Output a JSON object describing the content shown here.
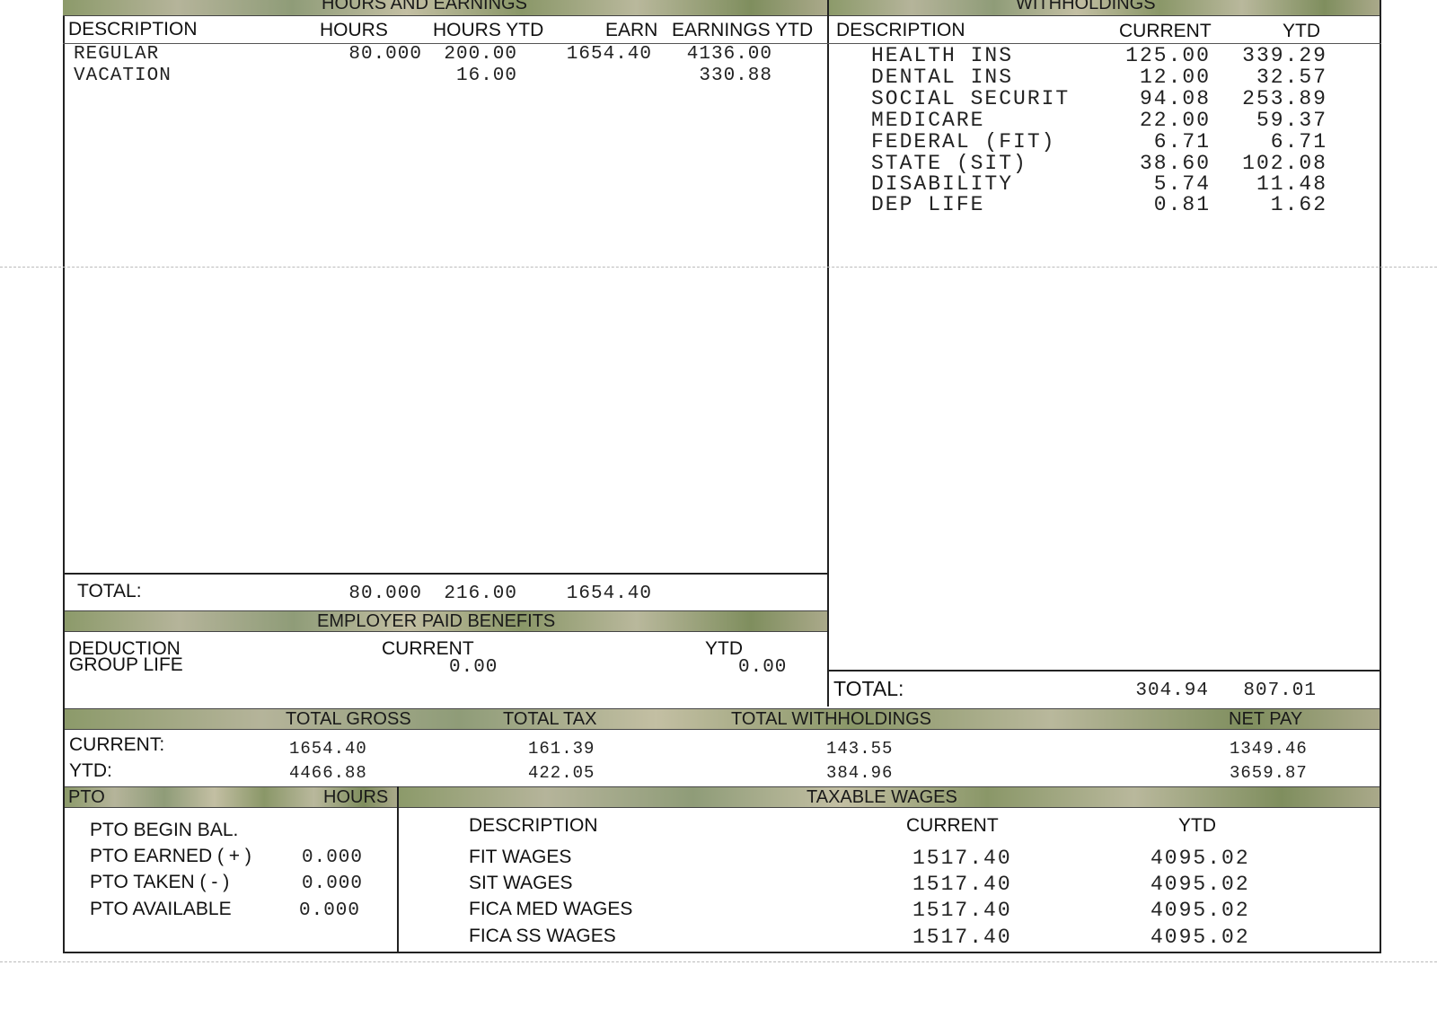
{
  "hours_earnings": {
    "title": "HOURS AND EARNINGS",
    "headers": [
      "DESCRIPTION",
      "HOURS",
      "HOURS YTD",
      "EARN",
      "EARNINGS YTD"
    ],
    "rows": [
      {
        "description": "REGULAR",
        "hours": "80.000",
        "hours_ytd": "200.00",
        "earn": "1654.40",
        "earnings_ytd": "4136.00"
      },
      {
        "description": "VACATION",
        "hours": "",
        "hours_ytd": "16.00",
        "earn": "",
        "earnings_ytd": "330.88"
      }
    ],
    "total": {
      "label": "TOTAL:",
      "hours": "80.000",
      "hours_ytd": "216.00",
      "earn": "1654.40"
    }
  },
  "withholdings": {
    "title": "WITHHOLDINGS",
    "headers": [
      "DESCRIPTION",
      "CURRENT",
      "YTD"
    ],
    "rows": [
      {
        "description": "HEALTH INS",
        "current": "125.00",
        "ytd": "339.29"
      },
      {
        "description": "DENTAL INS",
        "current": "12.00",
        "ytd": "32.57"
      },
      {
        "description": "SOCIAL SECURIT",
        "current": "94.08",
        "ytd": "253.89"
      },
      {
        "description": "MEDICARE",
        "current": "22.00",
        "ytd": "59.37"
      },
      {
        "description": "FEDERAL (FIT)",
        "current": "6.71",
        "ytd": "6.71"
      },
      {
        "description": "STATE (SIT)",
        "current": "38.60",
        "ytd": "102.08"
      },
      {
        "description": "DISABILITY",
        "current": "5.74",
        "ytd": "11.48"
      },
      {
        "description": "DEP LIFE",
        "current": "0.81",
        "ytd": "1.62"
      }
    ],
    "total": {
      "label": "TOTAL:",
      "current": "304.94",
      "ytd": "807.01"
    }
  },
  "employer_benefits": {
    "title": "EMPLOYER PAID BENEFITS",
    "headers": [
      "DEDUCTION",
      "CURRENT",
      "YTD"
    ],
    "rows": [
      {
        "description": "GROUP LIFE",
        "current": "0.00",
        "ytd": "0.00"
      }
    ]
  },
  "summary": {
    "headers": [
      "TOTAL GROSS",
      "TOTAL TAX",
      "TOTAL WITHHOLDINGS",
      "NET PAY"
    ],
    "current": {
      "label": "CURRENT:",
      "gross": "1654.40",
      "tax": "161.39",
      "withholdings": "143.55",
      "net": "1349.46"
    },
    "ytd": {
      "label": "YTD:",
      "gross": "4466.88",
      "tax": "422.05",
      "withholdings": "384.96",
      "net": "3659.87"
    }
  },
  "pto": {
    "title": "PTO",
    "hours_header": "HOURS",
    "rows": [
      {
        "label": "PTO BEGIN BAL.",
        "hours": ""
      },
      {
        "label": "PTO EARNED ( + )",
        "hours": "0.000"
      },
      {
        "label": "PTO TAKEN ( - )",
        "hours": "0.000"
      },
      {
        "label": "PTO AVAILABLE",
        "hours": "0.000"
      }
    ]
  },
  "taxable_wages": {
    "title": "TAXABLE WAGES",
    "headers": [
      "DESCRIPTION",
      "CURRENT",
      "YTD"
    ],
    "rows": [
      {
        "description": "FIT WAGES",
        "current": "1517.40",
        "ytd": "4095.02"
      },
      {
        "description": "SIT WAGES",
        "current": "1517.40",
        "ytd": "4095.02"
      },
      {
        "description": "FICA MED WAGES",
        "current": "1517.40",
        "ytd": "4095.02"
      },
      {
        "description": "FICA SS WAGES",
        "current": "1517.40",
        "ytd": "4095.02"
      }
    ]
  }
}
